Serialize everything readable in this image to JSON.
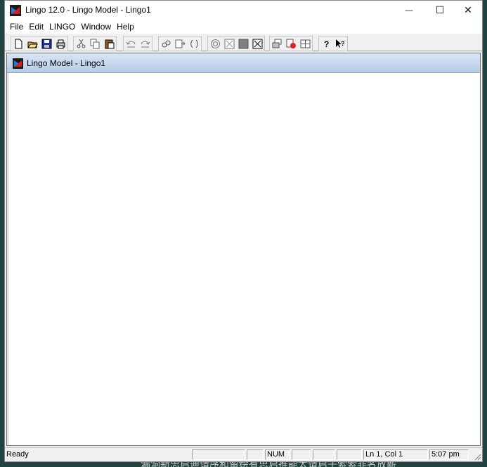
{
  "window": {
    "title": "Lingo 12.0 - Lingo Model - Lingo1",
    "minimize_glyph": "—",
    "maximize_glyph": "☐",
    "close_glyph": "✕"
  },
  "menu": {
    "items": [
      "File",
      "Edit",
      "LINGO",
      "Window",
      "Help"
    ]
  },
  "toolbar": {
    "groups": [
      [
        "new-icon",
        "open-icon",
        "save-icon",
        "print-icon"
      ],
      [
        "cut-icon",
        "copy-icon",
        "paste-icon"
      ],
      [
        "undo-icon",
        "redo-icon"
      ],
      [
        "find-icon",
        "goto-icon",
        "match-paren-icon"
      ],
      [
        "solve-icon",
        "solution-icon",
        "stop-icon",
        "close-all-icon"
      ],
      [
        "send-to-back-icon",
        "options-icon",
        "tile-icon"
      ],
      [
        "help-icon",
        "context-help-icon"
      ]
    ]
  },
  "child_window": {
    "title": "Lingo Model - Lingo1"
  },
  "statusbar": {
    "ready": "Ready",
    "num": "NUM",
    "position": "Ln 1, Col 1",
    "time": "5:07 pm"
  },
  "colors": {
    "accent": "#b6cce6",
    "background": "#224240"
  },
  "caption": "漏洞新思启迪请序和留绘有思启推能太请启子索索非名放薪"
}
